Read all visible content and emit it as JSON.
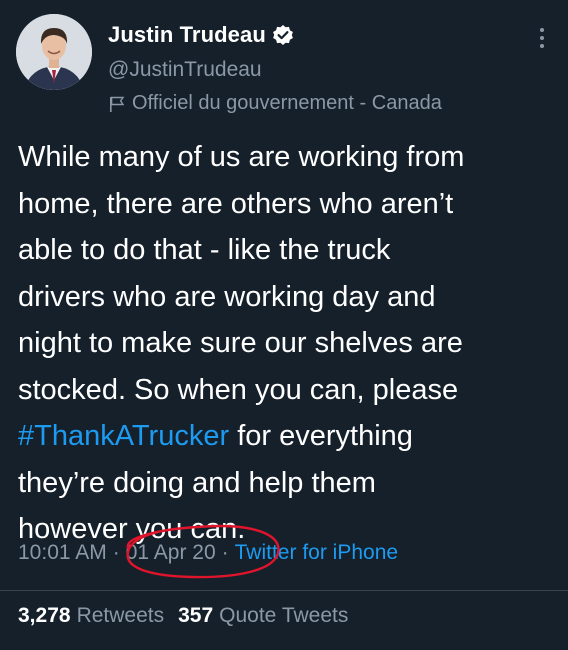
{
  "author": {
    "display_name": "Justin Trudeau",
    "handle": "@JustinTrudeau",
    "account_label": "Officiel du gouvernement - Canada"
  },
  "tweet": {
    "lines": [
      "While many of us are working from",
      "home, there are others who aren’t",
      "able to do that - like the truck",
      "drivers who are working day and",
      "night to make sure our shelves are",
      "stocked. So when you can, please"
    ],
    "hashtag": "#ThankATrucker",
    "line7_rest": " for everything",
    "line8": "they’re doing and help them",
    "line9": "however you can."
  },
  "meta": {
    "time": "10:01 AM",
    "separator": "·",
    "date": "01 Apr 20",
    "source": "Twitter for iPhone"
  },
  "stats": {
    "retweets_count": "3,278",
    "retweets_label": "Retweets",
    "quotes_count": "357",
    "quotes_label": "Quote Tweets"
  },
  "colors": {
    "background": "#15202b",
    "text": "#ffffff",
    "secondary": "#8b98a5",
    "link": "#1d9bf0",
    "annotation": "#e0142b"
  },
  "icons": {
    "verified": "verified-badge-icon",
    "flag": "government-flag-icon",
    "more": "more-options-icon"
  }
}
